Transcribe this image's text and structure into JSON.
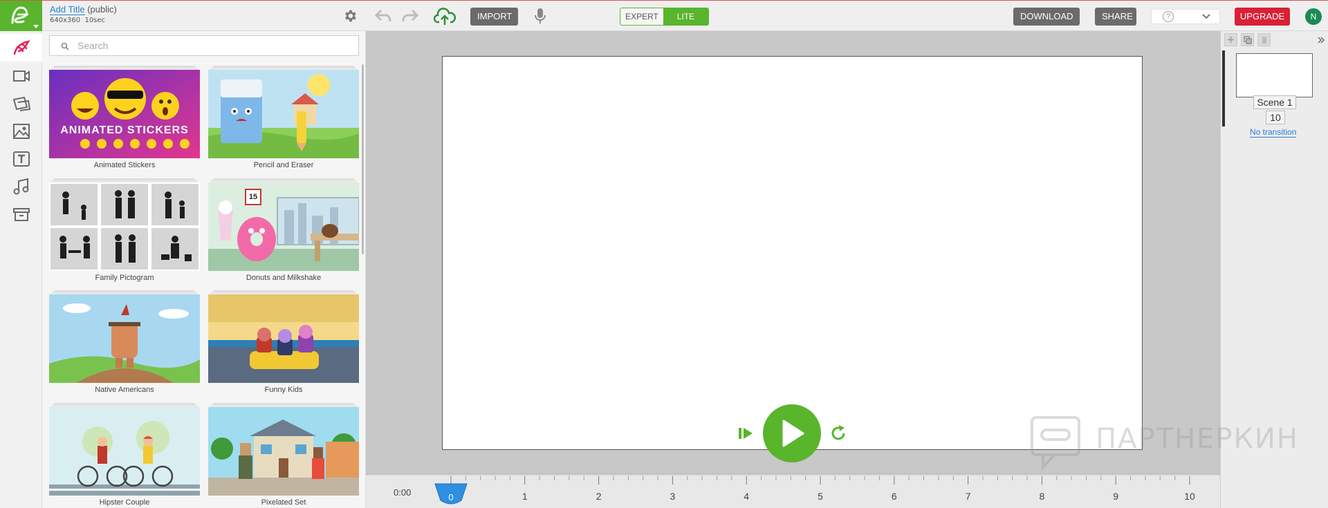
{
  "app": {
    "logo": "animaker-logo-icon",
    "brand_color": "#58b52c",
    "project": {
      "title_link": "Add Title",
      "visibility": "(public)",
      "resolution": "640x360",
      "duration": "10sec"
    }
  },
  "toolbar": {
    "import_label": "IMPORT",
    "mode": {
      "expert_label": "EXPERT",
      "lite_label": "LITE",
      "selected": "LITE"
    },
    "download_label": "DOWNLOAD",
    "share_label": "SHARE",
    "help_icon": "?",
    "upgrade_label": "UPGRADE",
    "upgrade_color": "#d92035",
    "avatar_initial": "N"
  },
  "rail": [
    "character-icon",
    "video-icon",
    "scene-icon",
    "image-icon",
    "text-icon",
    "music-icon",
    "archive-icon"
  ],
  "asset_panel": {
    "search_placeholder": "Search",
    "cards": [
      {
        "caption": "Animated Stickers",
        "banner": "ANIMATED STICKERS"
      },
      {
        "caption": "Pencil and Eraser"
      },
      {
        "caption": "Family Pictogram"
      },
      {
        "caption": "Donuts and Milkshake",
        "calendar_day": "15"
      },
      {
        "caption": "Native Americans"
      },
      {
        "caption": "Funny Kids"
      },
      {
        "caption": "Hipster Couple"
      },
      {
        "caption": "Pixelated Set"
      }
    ]
  },
  "timeline": {
    "time_readout": "0:00",
    "playhead": "0",
    "ticks": [
      "1",
      "2",
      "3",
      "4",
      "5",
      "6",
      "7",
      "8",
      "9",
      "10"
    ]
  },
  "scenes": {
    "items": [
      {
        "name": "Scene 1",
        "duration": "10",
        "transition": "No transition"
      }
    ]
  },
  "watermark": "ПАРТНЕРКИН"
}
